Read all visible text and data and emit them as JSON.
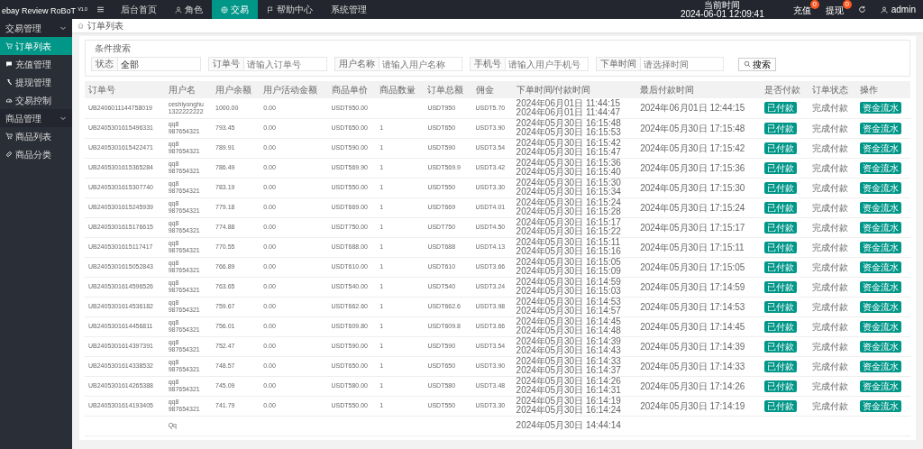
{
  "topbar": {
    "brand": "ebay Review RoBoT",
    "version": "V1.0",
    "nav": [
      {
        "label": "后台首页",
        "selected": false
      },
      {
        "label": "角色",
        "selected": false
      },
      {
        "label": "交易",
        "selected": true
      },
      {
        "label": "帮助中心",
        "selected": false
      },
      {
        "label": "系统管理",
        "selected": false
      }
    ],
    "clock": {
      "label": "当前时间",
      "value": "2024-06-01 12:09:41"
    },
    "actions": [
      {
        "label": "充值",
        "count": "0"
      },
      {
        "label": "提现",
        "count": "0"
      }
    ],
    "user": "admin"
  },
  "sidebar": [
    {
      "label": "交易管理",
      "expanded": true,
      "items": [
        {
          "label": "订单列表",
          "selected": true
        },
        {
          "label": "充值管理",
          "selected": false
        },
        {
          "label": "提现管理",
          "selected": false
        },
        {
          "label": "交易控制",
          "selected": false
        }
      ]
    },
    {
      "label": "商品管理",
      "expanded": true,
      "items": [
        {
          "label": "商品列表",
          "selected": false
        },
        {
          "label": "商品分类",
          "selected": false
        }
      ]
    }
  ],
  "breadcrumb": "订单列表",
  "search": {
    "legend": "条件搜索",
    "fields": [
      {
        "kind": "select",
        "label": "状态",
        "value": "全部"
      },
      {
        "kind": "text",
        "label": "订单号",
        "placeholder": "请输入订单号"
      },
      {
        "kind": "text",
        "label": "用户名称",
        "placeholder": "请输入用户名称"
      },
      {
        "kind": "text",
        "label": "手机号",
        "placeholder": "请输入用户手机号"
      },
      {
        "kind": "text",
        "label": "下单时间",
        "placeholder": "请选择时间"
      }
    ],
    "button": "搜索"
  },
  "table": {
    "columns": [
      "订单号",
      "用户名",
      "用户余额",
      "用户活动金额",
      "商品单价",
      "商品数量",
      "订单总额",
      "佣金",
      "下单时间/付款时间",
      "最后付款时间",
      "是否付款",
      "订单状态",
      "操作"
    ],
    "rows": [
      {
        "order_no": "UB2406011144758019",
        "user_name": "ceshiyonghu",
        "phone": "1322222222",
        "balance": "1000.00",
        "activity": "0.00",
        "price": "USDT950.00",
        "total": "USDT950",
        "commission": "USDT5.70",
        "order_time": "2024年06月01日 11:44:15",
        "pay_time": "2024年06月01日 11:44:47",
        "last_pay_time": "2024年06月01日 12:44:15",
        "paid": "已付款",
        "status": "完成付款",
        "action": "资金流水"
      },
      {
        "order_no": "UB2405301615496331",
        "user_name": "qq8",
        "phone": "987654321",
        "balance": "793.45",
        "activity": "0.00",
        "price": "USDT650.00",
        "qty": "1",
        "total": "USDT650",
        "commission": "USDT3.90",
        "order_time": "2024年05月30日 16:15:48",
        "pay_time": "2024年05月30日 16:15:53",
        "last_pay_time": "2024年05月30日 17:15:48",
        "paid": "已付款",
        "status": "完成付款",
        "action": "资金流水"
      },
      {
        "order_no": "UB2405301615422471",
        "user_name": "qq8",
        "phone": "987654321",
        "balance": "789.91",
        "activity": "0.00",
        "price": "USDT590.00",
        "qty": "1",
        "total": "USDT590",
        "commission": "USDT3.54",
        "order_time": "2024年05月30日 16:15:42",
        "pay_time": "2024年05月30日 16:15:47",
        "last_pay_time": "2024年05月30日 17:15:42",
        "paid": "已付款",
        "status": "完成付款",
        "action": "资金流水"
      },
      {
        "order_no": "UB2405301615365284",
        "user_name": "qq8",
        "phone": "987654321",
        "balance": "786.49",
        "activity": "0.00",
        "price": "USDT569.90",
        "qty": "1",
        "total": "USDT569.9",
        "commission": "USDT3.42",
        "order_time": "2024年05月30日 16:15:36",
        "pay_time": "2024年05月30日 16:15:40",
        "last_pay_time": "2024年05月30日 17:15:36",
        "paid": "已付款",
        "status": "完成付款",
        "action": "资金流水"
      },
      {
        "order_no": "UB2405301615307740",
        "user_name": "qq8",
        "phone": "987654321",
        "balance": "783.19",
        "activity": "0.00",
        "price": "USDT550.00",
        "qty": "1",
        "total": "USDT550",
        "commission": "USDT3.30",
        "order_time": "2024年05月30日 16:15:30",
        "pay_time": "2024年05月30日 16:15:34",
        "last_pay_time": "2024年05月30日 17:15:30",
        "paid": "已付款",
        "status": "完成付款",
        "action": "资金流水"
      },
      {
        "order_no": "UB2405301615245939",
        "user_name": "qq8",
        "phone": "987654321",
        "balance": "779.18",
        "activity": "0.00",
        "price": "USDT669.00",
        "qty": "1",
        "total": "USDT669",
        "commission": "USDT4.01",
        "order_time": "2024年05月30日 16:15:24",
        "pay_time": "2024年05月30日 16:15:28",
        "last_pay_time": "2024年05月30日 17:15:24",
        "paid": "已付款",
        "status": "完成付款",
        "action": "资金流水"
      },
      {
        "order_no": "UB2405301615176615",
        "user_name": "qq8",
        "phone": "987654321",
        "balance": "774.88",
        "activity": "0.00",
        "price": "USDT750.00",
        "qty": "1",
        "total": "USDT750",
        "commission": "USDT4.50",
        "order_time": "2024年05月30日 16:15:17",
        "pay_time": "2024年05月30日 16:15:22",
        "last_pay_time": "2024年05月30日 17:15:17",
        "paid": "已付款",
        "status": "完成付款",
        "action": "资金流水"
      },
      {
        "order_no": "UB2405301615117417",
        "user_name": "qq8",
        "phone": "987654321",
        "balance": "770.55",
        "activity": "0.00",
        "price": "USDT688.00",
        "qty": "1",
        "total": "USDT688",
        "commission": "USDT4.13",
        "order_time": "2024年05月30日 16:15:11",
        "pay_time": "2024年05月30日 16:15:16",
        "last_pay_time": "2024年05月30日 17:15:11",
        "paid": "已付款",
        "status": "完成付款",
        "action": "资金流水"
      },
      {
        "order_no": "UB2405301615052843",
        "user_name": "qq8",
        "phone": "987654321",
        "balance": "766.89",
        "activity": "0.00",
        "price": "USDT610.00",
        "qty": "1",
        "total": "USDT610",
        "commission": "USDT3.66",
        "order_time": "2024年05月30日 16:15:05",
        "pay_time": "2024年05月30日 16:15:09",
        "last_pay_time": "2024年05月30日 17:15:05",
        "paid": "已付款",
        "status": "完成付款",
        "action": "资金流水"
      },
      {
        "order_no": "UB2405301614596526",
        "user_name": "qq8",
        "phone": "987654321",
        "balance": "763.65",
        "activity": "0.00",
        "price": "USDT540.00",
        "qty": "1",
        "total": "USDT540",
        "commission": "USDT3.24",
        "order_time": "2024年05月30日 16:14:59",
        "pay_time": "2024年05月30日 16:15:03",
        "last_pay_time": "2024年05月30日 17:14:59",
        "paid": "已付款",
        "status": "完成付款",
        "action": "资金流水"
      },
      {
        "order_no": "UB2405301614536182",
        "user_name": "qq8",
        "phone": "987654321",
        "balance": "759.67",
        "activity": "0.00",
        "price": "USDT662.60",
        "qty": "1",
        "total": "USDT662.6",
        "commission": "USDT3.98",
        "order_time": "2024年05月30日 16:14:53",
        "pay_time": "2024年05月30日 16:14:57",
        "last_pay_time": "2024年05月30日 17:14:53",
        "paid": "已付款",
        "status": "完成付款",
        "action": "资金流水"
      },
      {
        "order_no": "UB2405301614456811",
        "user_name": "qq8",
        "phone": "987654321",
        "balance": "756.01",
        "activity": "0.00",
        "price": "USDT609.80",
        "qty": "1",
        "total": "USDT609.8",
        "commission": "USDT3.66",
        "order_time": "2024年05月30日 16:14:45",
        "pay_time": "2024年05月30日 16:14:48",
        "last_pay_time": "2024年05月30日 17:14:45",
        "paid": "已付款",
        "status": "完成付款",
        "action": "资金流水"
      },
      {
        "order_no": "UB2405301614397391",
        "user_name": "qq8",
        "phone": "987654321",
        "balance": "752.47",
        "activity": "0.00",
        "price": "USDT590.00",
        "qty": "1",
        "total": "USDT590",
        "commission": "USDT3.54",
        "order_time": "2024年05月30日 16:14:39",
        "pay_time": "2024年05月30日 16:14:43",
        "last_pay_time": "2024年05月30日 17:14:39",
        "paid": "已付款",
        "status": "完成付款",
        "action": "资金流水"
      },
      {
        "order_no": "UB2405301614338532",
        "user_name": "qq8",
        "phone": "987654321",
        "balance": "748.57",
        "activity": "0.00",
        "price": "USDT650.00",
        "qty": "1",
        "total": "USDT650",
        "commission": "USDT3.90",
        "order_time": "2024年05月30日 16:14:33",
        "pay_time": "2024年05月30日 16:14:37",
        "last_pay_time": "2024年05月30日 17:14:33",
        "paid": "已付款",
        "status": "完成付款",
        "action": "资金流水"
      },
      {
        "order_no": "UB2405301614265388",
        "user_name": "qq8",
        "phone": "987654321",
        "balance": "745.09",
        "activity": "0.00",
        "price": "USDT580.00",
        "qty": "1",
        "total": "USDT580",
        "commission": "USDT3.48",
        "order_time": "2024年05月30日 16:14:26",
        "pay_time": "2024年05月30日 16:14:31",
        "last_pay_time": "2024年05月30日 17:14:26",
        "paid": "已付款",
        "status": "完成付款",
        "action": "资金流水"
      },
      {
        "order_no": "UB2405301614193405",
        "user_name": "qq8",
        "phone": "987654321",
        "balance": "741.79",
        "activity": "0.00",
        "price": "USDT550.00",
        "qty": "1",
        "total": "USDT550",
        "commission": "USDT3.30",
        "order_time": "2024年05月30日 16:14:19",
        "pay_time": "2024年05月30日 16:14:24",
        "last_pay_time": "2024年05月30日 17:14:19",
        "paid": "已付款",
        "status": "完成付款",
        "action": "资金流水"
      },
      {
        "user_name": "Qq",
        "order_time": "2024年05月30日 14:44:14"
      }
    ]
  }
}
